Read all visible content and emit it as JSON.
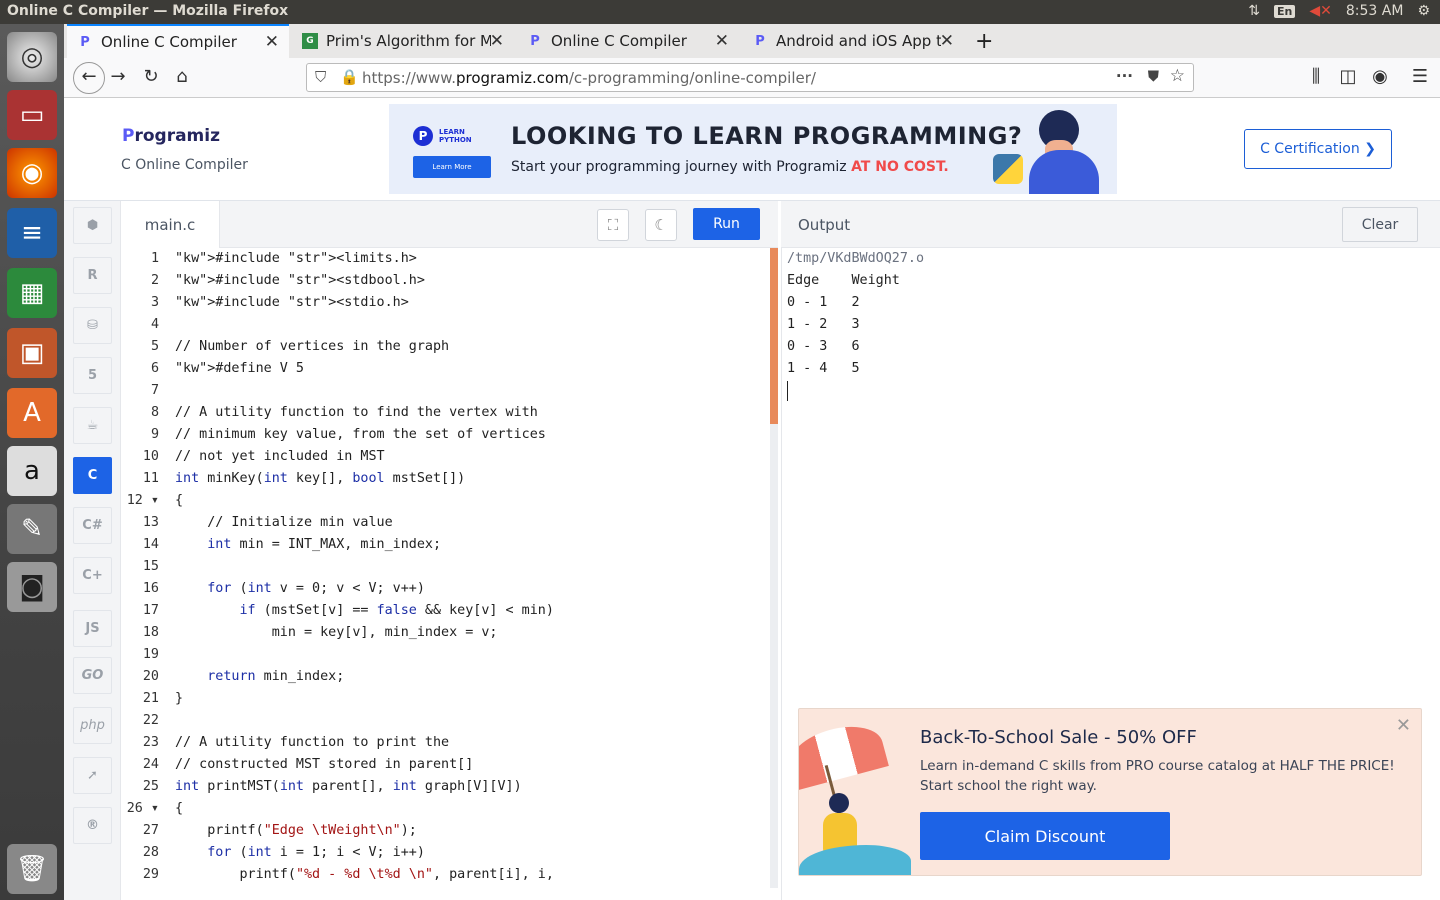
{
  "os": {
    "window_title": "Online C Compiler — Mozilla Firefox",
    "lang": "En",
    "time": "8:53 AM"
  },
  "tabs": [
    {
      "label": "Online C Compiler"
    },
    {
      "label": "Prim's Algorithm for Mir"
    },
    {
      "label": "Online C Compiler"
    },
    {
      "label": "Android and iOS App to"
    }
  ],
  "url": {
    "pre": "https://www.",
    "host": "programiz.com",
    "path": "/c-programming/online-compiler/"
  },
  "header": {
    "logo_p": "P",
    "logo_rest": "rogramiz",
    "subtitle": "C Online Compiler",
    "cert": "C Certification ❯"
  },
  "ad": {
    "badge_l1": "LEARN",
    "badge_l2": "PYTHON",
    "badge_btn": "Learn More",
    "headline": "LOOKING TO LEARN PROGRAMMING?",
    "sub": "Start your programming journey with Programiz",
    "sub_em": "AT NO COST."
  },
  "langs": [
    "python",
    "R",
    "SQL",
    "HTML",
    "Java",
    "C",
    "C#",
    "C++",
    "JS",
    "GO",
    "php",
    "Swift",
    "R"
  ],
  "editor": {
    "filename": "main.c",
    "run": "Run"
  },
  "code": [
    {
      "n": "1",
      "c": "#include <limits.h>"
    },
    {
      "n": "2",
      "c": "#include <stdbool.h>"
    },
    {
      "n": "3",
      "c": "#include <stdio.h>"
    },
    {
      "n": "4",
      "c": ""
    },
    {
      "n": "5",
      "c": "// Number of vertices in the graph"
    },
    {
      "n": "6",
      "c": "#define V 5"
    },
    {
      "n": "7",
      "c": ""
    },
    {
      "n": "8",
      "c": "// A utility function to find the vertex with"
    },
    {
      "n": "9",
      "c": "// minimum key value, from the set of vertices"
    },
    {
      "n": "10",
      "c": "// not yet included in MST"
    },
    {
      "n": "11",
      "c": "int minKey(int key[], bool mstSet[])"
    },
    {
      "n": "12 ▾",
      "c": "{"
    },
    {
      "n": "13",
      "c": "    // Initialize min value"
    },
    {
      "n": "14",
      "c": "    int min = INT_MAX, min_index;"
    },
    {
      "n": "15",
      "c": ""
    },
    {
      "n": "16",
      "c": "    for (int v = 0; v < V; v++)"
    },
    {
      "n": "17",
      "c": "        if (mstSet[v] == false && key[v] < min)"
    },
    {
      "n": "18",
      "c": "            min = key[v], min_index = v;"
    },
    {
      "n": "19",
      "c": ""
    },
    {
      "n": "20",
      "c": "    return min_index;"
    },
    {
      "n": "21",
      "c": "}"
    },
    {
      "n": "22",
      "c": ""
    },
    {
      "n": "23",
      "c": "// A utility function to print the"
    },
    {
      "n": "24",
      "c": "// constructed MST stored in parent[]"
    },
    {
      "n": "25",
      "c": "int printMST(int parent[], int graph[V][V])"
    },
    {
      "n": "26 ▾",
      "c": "{"
    },
    {
      "n": "27",
      "c": "    printf(\"Edge \\tWeight\\n\");"
    },
    {
      "n": "28",
      "c": "    for (int i = 1; i < V; i++)"
    },
    {
      "n": "29",
      "c": "        printf(\"%d - %d \\t%d \\n\", parent[i], i,"
    }
  ],
  "output": {
    "title": "Output",
    "clear": "Clear",
    "lines": [
      "/tmp/VKdBWdOQ27.o",
      "Edge    Weight",
      "0 - 1   2",
      "1 - 2   3",
      "0 - 3   6",
      "1 - 4   5"
    ]
  },
  "promo": {
    "title": "Back-To-School Sale - 50% OFF",
    "line1": "Learn in-demand C skills from PRO course catalog at HALF THE PRICE!",
    "line2": "Start school the right way.",
    "button": "Claim Discount"
  }
}
